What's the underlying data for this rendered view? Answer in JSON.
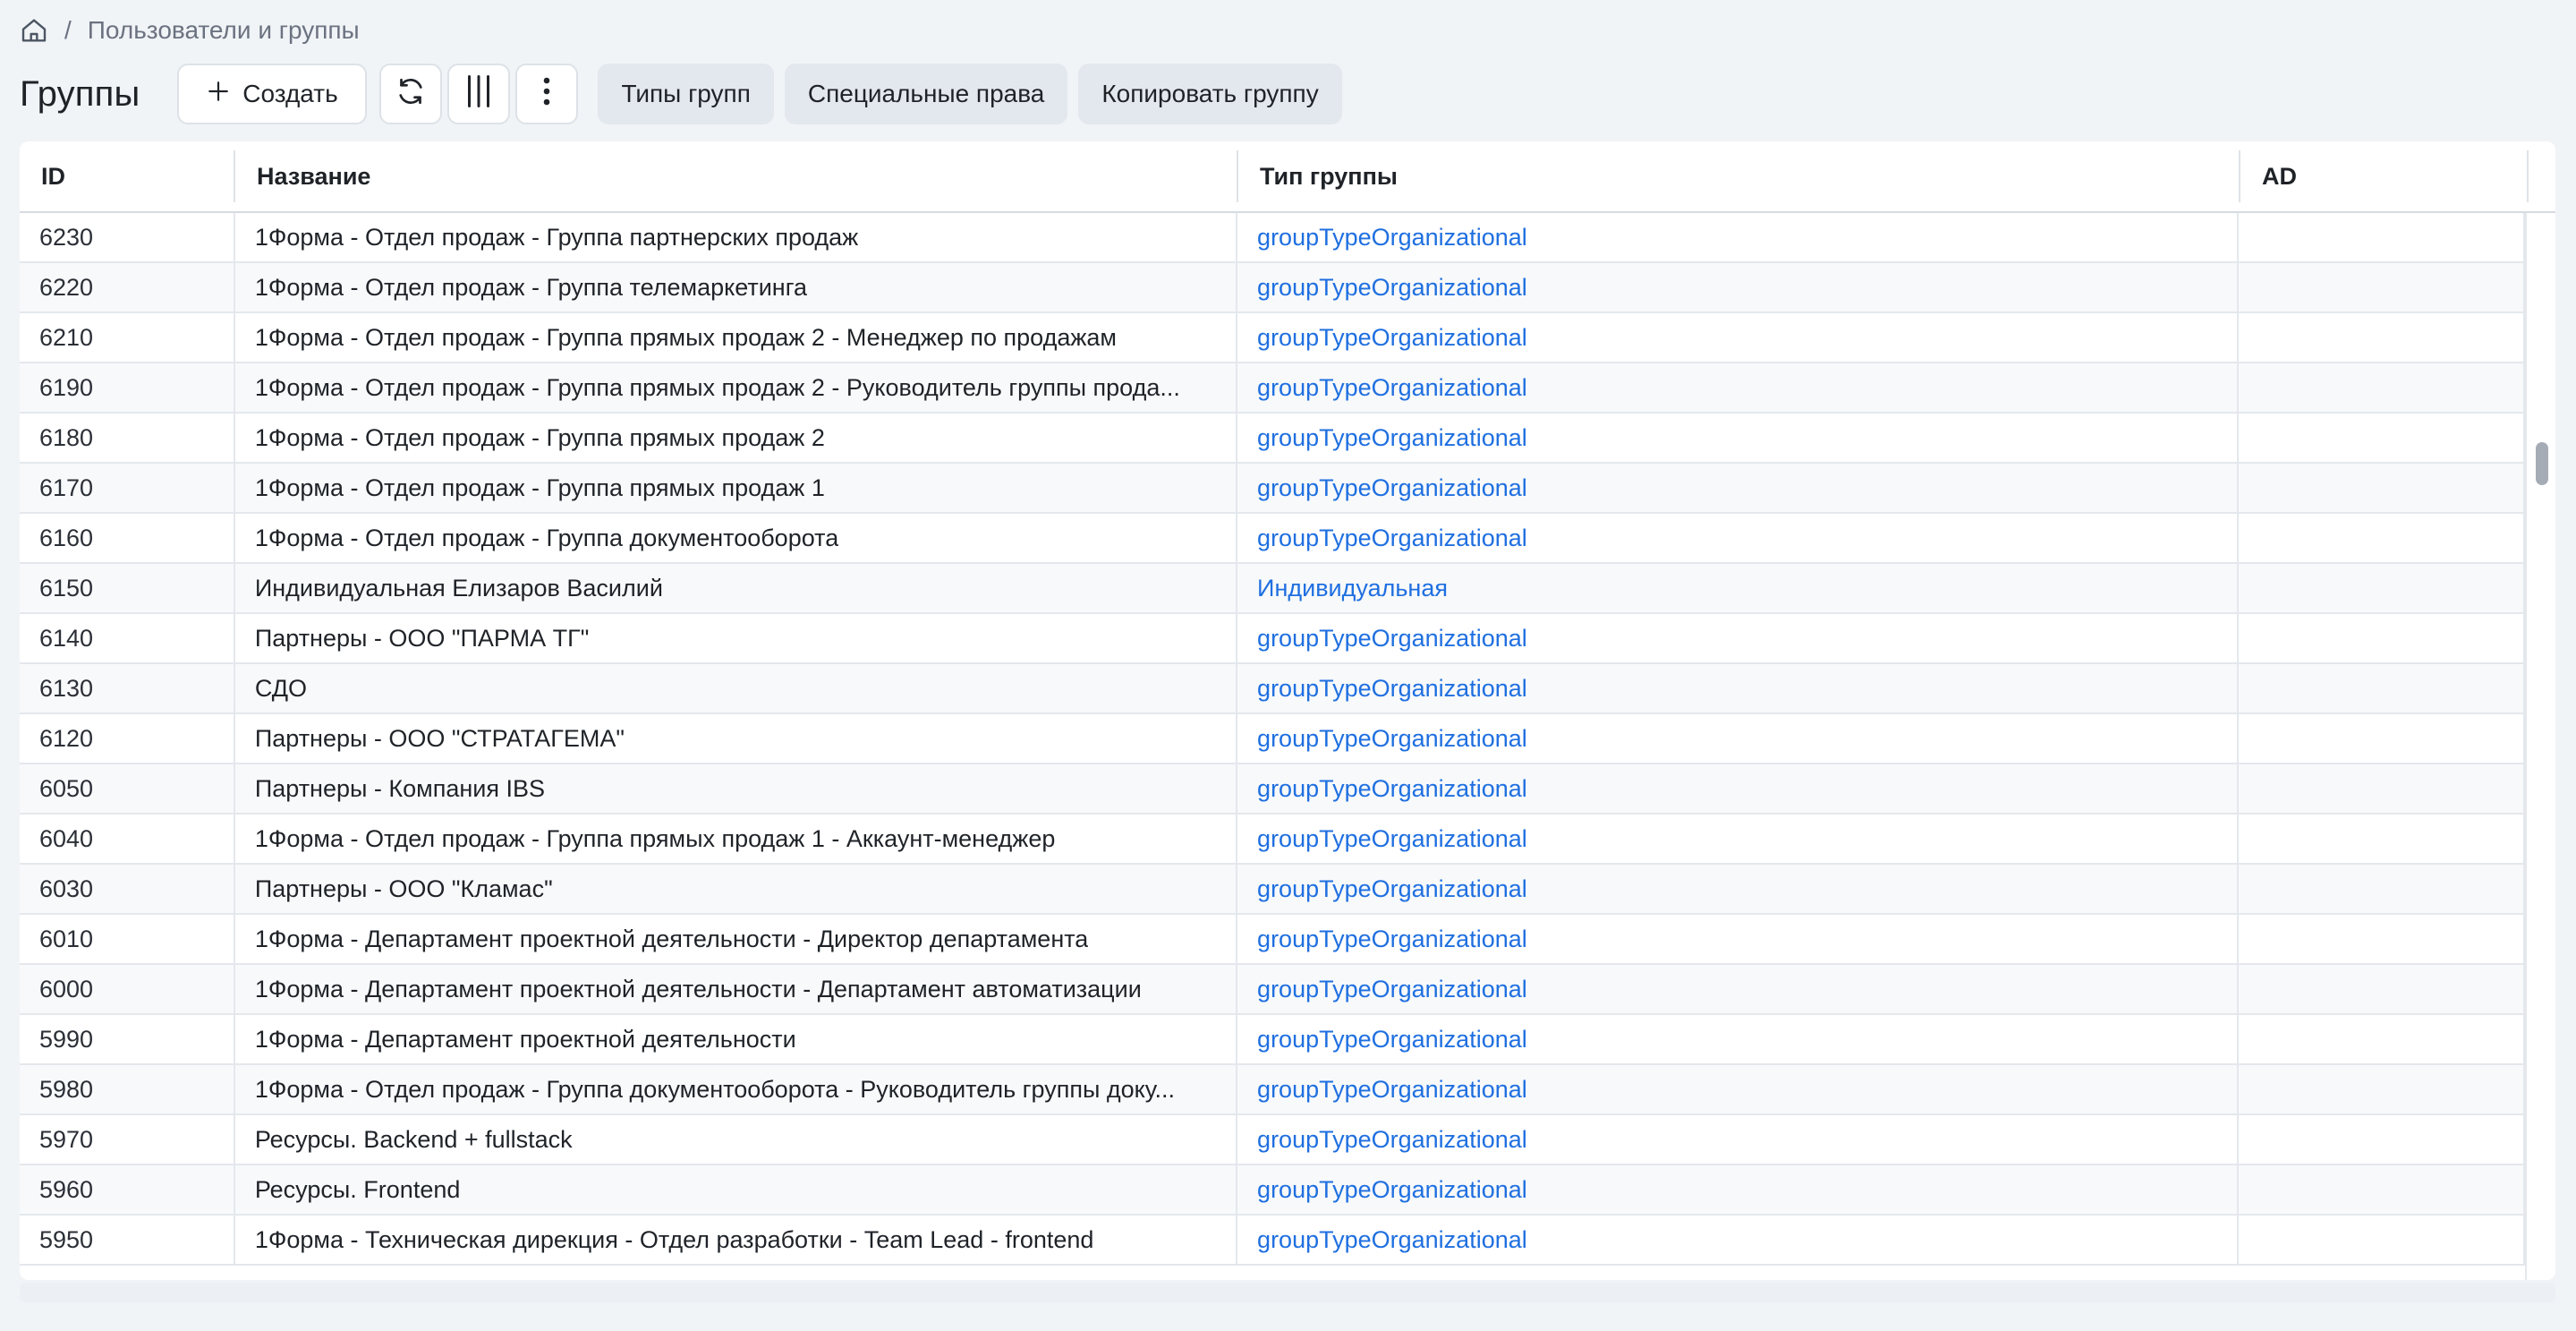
{
  "breadcrumb": {
    "separator": "/",
    "current": "Пользователи и группы"
  },
  "toolbar": {
    "title": "Группы",
    "create_label": "Создать",
    "group_types_label": "Типы групп",
    "special_rights_label": "Специальные права",
    "copy_group_label": "Копировать группу"
  },
  "icons": [
    "home-icon",
    "plus-icon",
    "refresh-icon",
    "columns-icon",
    "more-vertical-icon"
  ],
  "colors": {
    "link": "#1f6fe0",
    "background": "#f1f4f7",
    "header_border": "#d6dbe1"
  },
  "table": {
    "columns": [
      "ID",
      "Название",
      "Тип группы",
      "AD"
    ],
    "rows": [
      {
        "id": "6230",
        "name": "1Форма - Отдел продаж - Группа партнерских продаж",
        "type": "groupTypeOrganizational",
        "ad": ""
      },
      {
        "id": "6220",
        "name": "1Форма - Отдел продаж - Группа телемаркетинга",
        "type": "groupTypeOrganizational",
        "ad": ""
      },
      {
        "id": "6210",
        "name": "1Форма - Отдел продаж - Группа прямых продаж 2 - Менеджер по продажам",
        "type": "groupTypeOrganizational",
        "ad": ""
      },
      {
        "id": "6190",
        "name": "1Форма - Отдел продаж - Группа прямых продаж 2 - Руководитель группы прода...",
        "type": "groupTypeOrganizational",
        "ad": ""
      },
      {
        "id": "6180",
        "name": "1Форма - Отдел продаж - Группа прямых продаж 2",
        "type": "groupTypeOrganizational",
        "ad": ""
      },
      {
        "id": "6170",
        "name": "1Форма - Отдел продаж - Группа прямых продаж 1",
        "type": "groupTypeOrganizational",
        "ad": ""
      },
      {
        "id": "6160",
        "name": "1Форма - Отдел продаж - Группа документооборота",
        "type": "groupTypeOrganizational",
        "ad": ""
      },
      {
        "id": "6150",
        "name": "Индивидуальная Елизаров Василий",
        "type": "Индивидуальная",
        "ad": ""
      },
      {
        "id": "6140",
        "name": "Партнеры - ООО \"ПАРМА ТГ\"",
        "type": "groupTypeOrganizational",
        "ad": ""
      },
      {
        "id": "6130",
        "name": "СДО",
        "type": "groupTypeOrganizational",
        "ad": ""
      },
      {
        "id": "6120",
        "name": "Партнеры - ООО \"СТРАТАГЕМА\"",
        "type": "groupTypeOrganizational",
        "ad": ""
      },
      {
        "id": "6050",
        "name": "Партнеры - Компания IBS",
        "type": "groupTypeOrganizational",
        "ad": ""
      },
      {
        "id": "6040",
        "name": "1Форма - Отдел продаж - Группа прямых продаж 1 - Аккаунт-менеджер",
        "type": "groupTypeOrganizational",
        "ad": ""
      },
      {
        "id": "6030",
        "name": "Партнеры - ООО \"Кламас\"",
        "type": "groupTypeOrganizational",
        "ad": ""
      },
      {
        "id": "6010",
        "name": "1Форма - Департамент проектной деятельности - Директор департамента",
        "type": "groupTypeOrganizational",
        "ad": ""
      },
      {
        "id": "6000",
        "name": "1Форма - Департамент проектной деятельности - Департамент автоматизации",
        "type": "groupTypeOrganizational",
        "ad": ""
      },
      {
        "id": "5990",
        "name": "1Форма - Департамент проектной деятельности",
        "type": "groupTypeOrganizational",
        "ad": ""
      },
      {
        "id": "5980",
        "name": "1Форма - Отдел продаж - Группа документооборота - Руководитель группы доку...",
        "type": "groupTypeOrganizational",
        "ad": ""
      },
      {
        "id": "5970",
        "name": "Ресурсы. Backend + fullstack",
        "type": "groupTypeOrganizational",
        "ad": ""
      },
      {
        "id": "5960",
        "name": "Ресурсы. Frontend",
        "type": "groupTypeOrganizational",
        "ad": ""
      },
      {
        "id": "5950",
        "name": "1Форма - Техническая дирекция - Отдел разработки - Team Lead - frontend",
        "type": "groupTypeOrganizational",
        "ad": ""
      }
    ]
  }
}
